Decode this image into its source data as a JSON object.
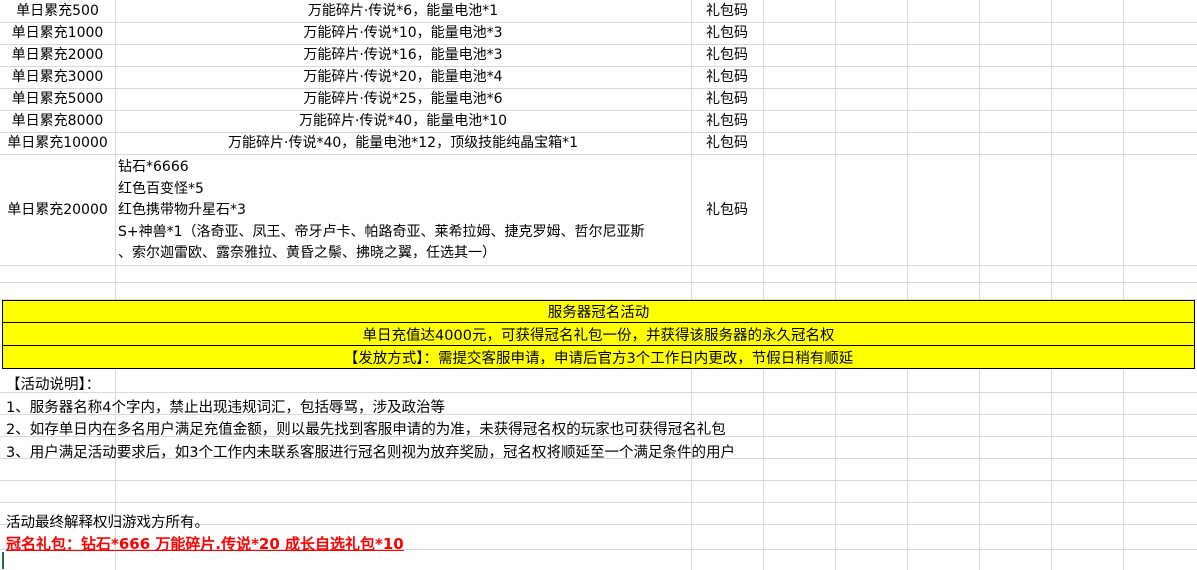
{
  "rows": [
    {
      "tier": "单日累充500",
      "reward": "万能碎片·传说*6，能量电池*1",
      "type": "礼包码"
    },
    {
      "tier": "单日累充1000",
      "reward": "万能碎片·传说*10，能量电池*3",
      "type": "礼包码"
    },
    {
      "tier": "单日累充2000",
      "reward": "万能碎片·传说*16，能量电池*3",
      "type": "礼包码"
    },
    {
      "tier": "单日累充3000",
      "reward": "万能碎片·传说*20，能量电池*4",
      "type": "礼包码"
    },
    {
      "tier": "单日累充5000",
      "reward": "万能碎片·传说*25，能量电池*6",
      "type": "礼包码"
    },
    {
      "tier": "单日累充8000",
      "reward": "万能碎片·传说*40，能量电池*10",
      "type": "礼包码"
    },
    {
      "tier": "单日累充10000",
      "reward": "万能碎片·传说*40，能量电池*12，顶级技能纯晶宝箱*1",
      "type": "礼包码"
    }
  ],
  "big_row": {
    "tier": "单日累充20000",
    "lines": [
      "钻石*6666",
      "红色百变怪*5",
      "红色携带物升星石*3",
      "S+神兽*1（洛奇亚、凤王、帝牙卢卡、帕路奇亚、莱希拉姆、捷克罗姆、哲尔尼亚斯",
      "、索尔迦雷欧、露奈雅拉、黄昏之鬃、拂晓之翼，任选其一）"
    ],
    "type": "礼包码"
  },
  "banner": {
    "title": "服务器冠名活动",
    "condition": "单日充值达4000元，可获得冠名礼包一份，并获得该服务器的永久冠名权",
    "method": "【发放方式】：需提交客服申请，申请后官方3个工作日内更改，节假日稍有顺延"
  },
  "notes": {
    "heading": "【活动说明】：",
    "items": [
      "1、服务器名称4个字内，禁止出现违规词汇，包括辱骂，涉及政治等",
      "2、如存单日内在多名用户满足充值金额，则以最先找到客服申请的为准，未获得冠名权的玩家也可获得冠名礼包",
      "3、用户满足活动要求后，如3个工作内未联系客服进行冠名则视为放弃奖励，冠名权将顺延至一个满足条件的用户"
    ],
    "final": "活动最终解释权归游戏方所有。",
    "reward": "冠名礼包：钻石*666 万能碎片.传说*20 成长自选礼包*10 "
  },
  "colors": {
    "banner_bg": "#ffff00",
    "reward_text": "#ff0000",
    "grid": "#d9d9d9"
  }
}
